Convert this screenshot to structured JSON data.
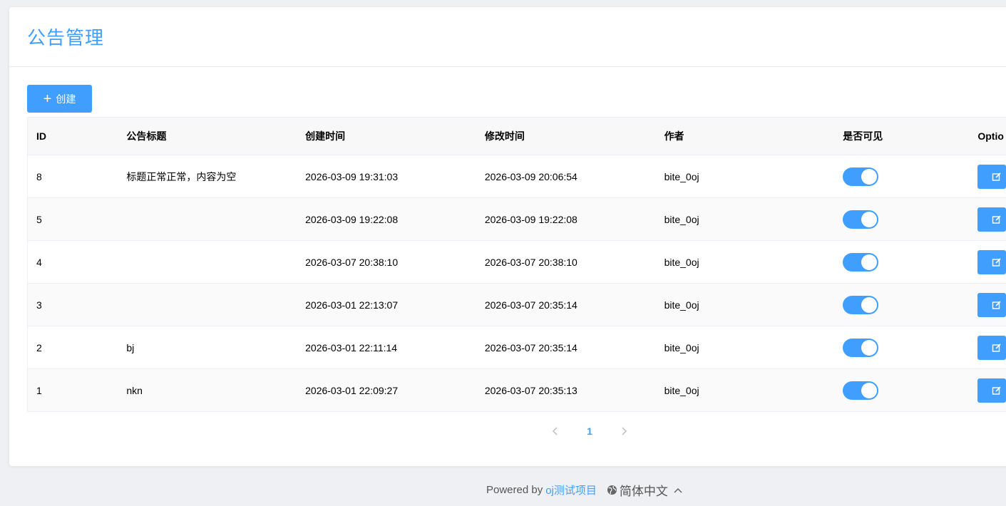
{
  "header": {
    "title": "公告管理"
  },
  "toolbar": {
    "create_label": "创建"
  },
  "table": {
    "columns": [
      "ID",
      "公告标题",
      "创建时间",
      "修改时间",
      "作者",
      "是否可见",
      "Optio"
    ],
    "rows": [
      {
        "id": "8",
        "title": "标题正常正常，内容为空",
        "created": "2026-03-09 19:31:03",
        "modified": "2026-03-09 20:06:54",
        "author": "bite_0oj",
        "visible": true
      },
      {
        "id": "5",
        "title": "",
        "created": "2026-03-09 19:22:08",
        "modified": "2026-03-09 19:22:08",
        "author": "bite_0oj",
        "visible": true
      },
      {
        "id": "4",
        "title": "",
        "created": "2026-03-07 20:38:10",
        "modified": "2026-03-07 20:38:10",
        "author": "bite_0oj",
        "visible": true
      },
      {
        "id": "3",
        "title": "",
        "created": "2026-03-01 22:13:07",
        "modified": "2026-03-07 20:35:14",
        "author": "bite_0oj",
        "visible": true
      },
      {
        "id": "2",
        "title": "bj",
        "created": "2026-03-01 22:11:14",
        "modified": "2026-03-07 20:35:14",
        "author": "bite_0oj",
        "visible": true
      },
      {
        "id": "1",
        "title": "nkn",
        "created": "2026-03-01 22:09:27",
        "modified": "2026-03-07 20:35:13",
        "author": "bite_0oj",
        "visible": true
      }
    ]
  },
  "pagination": {
    "current_page": "1"
  },
  "footer": {
    "powered_by": "Powered by",
    "project_link": "oj测试项目",
    "language": "简体中文"
  },
  "colors": {
    "accent": "#409eff",
    "background": "#eef0f3"
  },
  "icons": {
    "create": "plus-icon",
    "edit": "edit-icon",
    "prev": "chevron-left-icon",
    "next": "chevron-right-icon",
    "language": "globe-icon",
    "dropdown": "chevron-up-icon"
  }
}
